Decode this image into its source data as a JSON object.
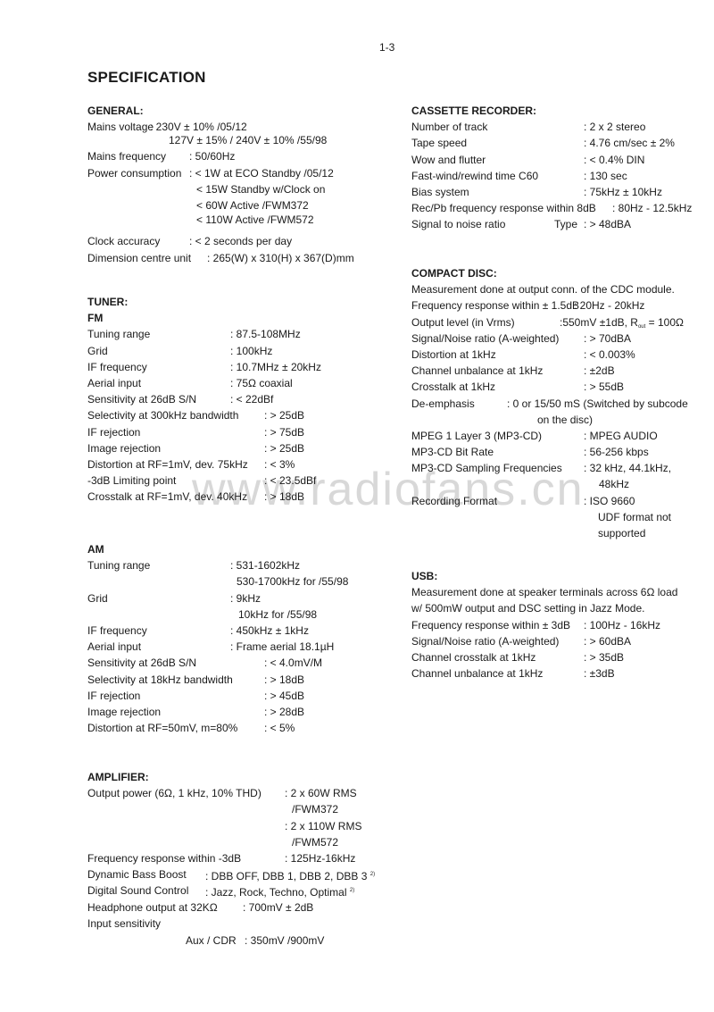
{
  "page_number": "1-3",
  "title": "SPECIFICATION",
  "watermark": "www.radiofans.cn",
  "general": {
    "heading": "GENERAL:",
    "rows": [
      {
        "label": "Mains voltage",
        "value": ": 230V ± 10%  /05/12"
      },
      {
        "label": "",
        "value": "127V ± 15% / 240V  ± 10%  /55/98"
      },
      {
        "label": "Mains frequency",
        "value": ": 50/60Hz"
      },
      {
        "label": "Power consumption",
        "value": ": < 1W at ECO Standby /05/12"
      },
      {
        "label": "",
        "value": "< 15W Standby w/Clock on"
      },
      {
        "label": "",
        "value": "< 60W   Active /FWM372"
      },
      {
        "label": "",
        "value": "< 110W  Active /FWM572"
      },
      {
        "label": "Clock accuracy",
        "value": ": < 2 seconds per day"
      },
      {
        "label": "Dimension centre unit",
        "value": ": 265(W) x 310(H) x 367(D)mm"
      }
    ]
  },
  "tuner": {
    "heading": "TUNER:",
    "fm": {
      "heading": "FM",
      "rows": [
        {
          "label": "Tuning range",
          "value": ": 87.5-108MHz"
        },
        {
          "label": "Grid",
          "value": ": 100kHz"
        },
        {
          "label": "IF frequency",
          "value": ": 10.7MHz ± 20kHz"
        },
        {
          "label": "Aerial input",
          "value": ": 75Ω coaxial"
        },
        {
          "label": "Sensitivity at 26dB S/N",
          "value": ": < 22dBf"
        },
        {
          "label": "Selectivity at 300kHz bandwidth",
          "value": ": > 25dB"
        },
        {
          "label": "IF rejection",
          "value": ": > 75dB"
        },
        {
          "label": "Image rejection",
          "value": ": > 25dB"
        },
        {
          "label": "Distortion at RF=1mV, dev. 75kHz",
          "value": ": < 3%"
        },
        {
          "label": "-3dB Limiting point",
          "value": ": < 23.5dBf"
        },
        {
          "label": "Crosstalk at RF=1mV, dev. 40kHz",
          "value": ": > 18dB"
        }
      ]
    },
    "am": {
      "heading": "AM",
      "rows": [
        {
          "label": "Tuning range",
          "value": ": 531-1602kHz"
        },
        {
          "label": "",
          "value": "530-1700kHz for /55/98"
        },
        {
          "label": "Grid",
          "value": ": 9kHz"
        },
        {
          "label": "",
          "value": "10kHz for /55/98"
        },
        {
          "label": "IF frequency",
          "value": ": 450kHz ± 1kHz"
        },
        {
          "label": "Aerial input",
          "value": ": Frame aerial 18.1µH"
        },
        {
          "label": "Sensitivity at 26dB S/N",
          "value": ": < 4.0mV/M"
        },
        {
          "label": "Selectivity at 18kHz bandwidth",
          "value": ": > 18dB"
        },
        {
          "label": "IF rejection",
          "value": ": > 45dB"
        },
        {
          "label": "Image rejection",
          "value": ": > 28dB"
        },
        {
          "label": "Distortion at RF=50mV, m=80%",
          "value": ": < 5%"
        }
      ]
    }
  },
  "amplifier": {
    "heading": "AMPLIFIER:",
    "rows": [
      {
        "label": "Output power (6Ω, 1 kHz, 10% THD)",
        "value": ": 2 x 60W RMS"
      },
      {
        "label": "",
        "value": "/FWM372"
      },
      {
        "label": "",
        "value": ": 2 x 110W RMS"
      },
      {
        "label": "",
        "value": "/FWM572"
      },
      {
        "label": "Frequency response within -3dB",
        "value": ": 125Hz-16kHz"
      },
      {
        "label": "Dynamic Bass Boost",
        "value": ": DBB OFF, DBB 1, DBB 2, DBB 3",
        "note": "2)"
      },
      {
        "label": "Digital Sound Control",
        "value": ": Jazz, Rock, Techno, Optimal",
        "note": "2)"
      },
      {
        "label": "Headphone output at 32KΩ",
        "value": ": 700mV  ± 2dB"
      },
      {
        "label": "Input sensitivity",
        "value": ""
      },
      {
        "label": "Aux / CDR",
        "value": ": 350mV /900mV"
      }
    ]
  },
  "cassette": {
    "heading": "CASSETTE RECORDER:",
    "rows": [
      {
        "label": "Number of track",
        "value": ": 2 x 2 stereo"
      },
      {
        "label": "Tape speed",
        "value": ": 4.76 cm/sec ± 2%"
      },
      {
        "label": "Wow and flutter",
        "value": ": < 0.4% DIN"
      },
      {
        "label": "Fast-wind/rewind time C60",
        "value": ": 130 sec"
      },
      {
        "label": "Bias system",
        "value": ": 75kHz ± 10kHz"
      },
      {
        "label": "Rec/Pb frequency response within 8dB",
        "value": ": 80Hz - 12.5kHz"
      },
      {
        "label": "Signal to noise ratio",
        "mid": "Type",
        "value": ": > 48dBA"
      }
    ]
  },
  "compact_disc": {
    "heading": "COMPACT DISC:",
    "intro": "Measurement done at output conn. of the CDC module.",
    "rows": [
      {
        "label": "Frequency response within ± 1.5dB",
        "value": ": 20Hz - 20kHz"
      },
      {
        "label": "Output level (in Vrms)",
        "value": ":550mV ±1dB, R",
        "sub": "out",
        "value_tail": " = 100Ω"
      },
      {
        "label": "Signal/Noise ratio (A-weighted)",
        "value": ": > 70dBA"
      },
      {
        "label": "Distortion at 1kHz",
        "value": ": < 0.003%"
      },
      {
        "label": "Channel unbalance at 1kHz",
        "value": ": ±2dB"
      },
      {
        "label": "Crosstalk at 1kHz",
        "value": ": > 55dB"
      },
      {
        "label": "De-emphasis",
        "value": ": 0 or 15/50 mS (Switched by subcode"
      },
      {
        "label": "",
        "value": "on the disc)"
      },
      {
        "label": "MPEG 1 Layer 3 (MP3-CD)",
        "value": ": MPEG AUDIO"
      },
      {
        "label": "MP3-CD Bit Rate",
        "value": ": 56-256 kbps"
      },
      {
        "label": "MP3-CD Sampling Frequencies",
        "value": ": 32 kHz, 44.1kHz,"
      },
      {
        "label": "",
        "value": "48kHz"
      },
      {
        "label": "Recording Format",
        "value": ": ISO 9660"
      },
      {
        "label": "",
        "value": "UDF format not"
      },
      {
        "label": "",
        "value": "supported"
      }
    ]
  },
  "usb": {
    "heading": "USB:",
    "intro": [
      "Measurement done at speaker terminals across 6Ω load",
      "w/ 500mW output and DSC setting in Jazz Mode."
    ],
    "rows": [
      {
        "label": "Frequency response within ± 3dB",
        "value": ": 100Hz - 16kHz"
      },
      {
        "label": "Signal/Noise ratio (A-weighted)",
        "value": ": > 60dBA"
      },
      {
        "label": "Channel crosstalk at 1kHz",
        "value": ": > 35dB"
      },
      {
        "label": "Channel unbalance at 1kHz",
        "value": ": ±3dB"
      }
    ]
  }
}
